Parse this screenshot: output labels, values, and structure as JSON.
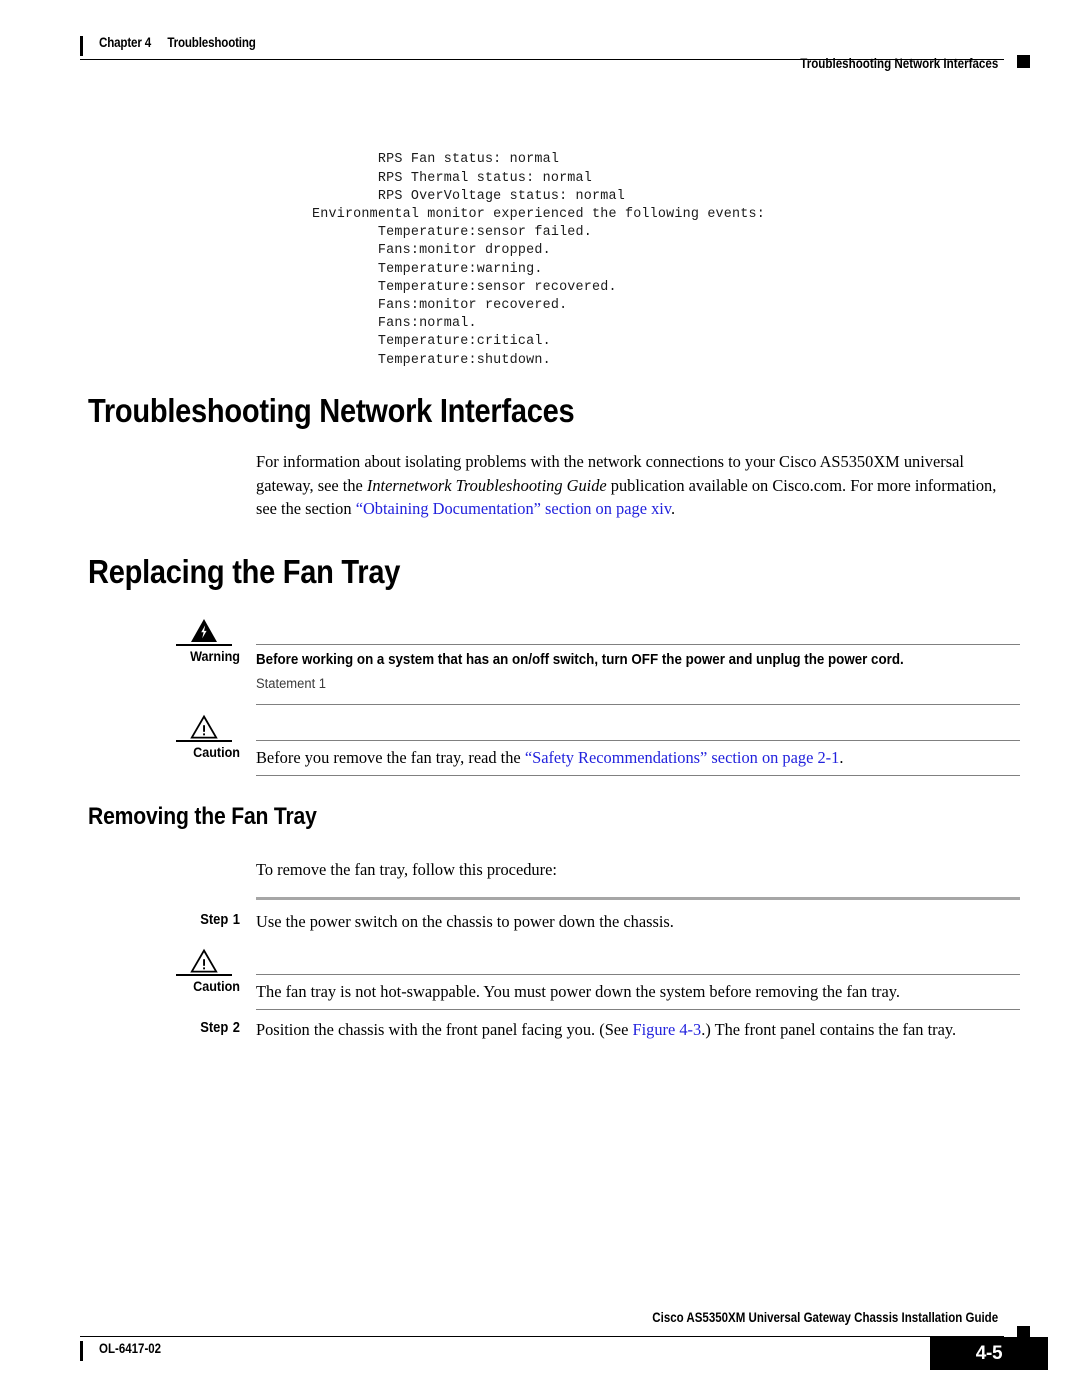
{
  "header": {
    "chapter": "Chapter 4",
    "chapter_title": "Troubleshooting",
    "running_head": "Troubleshooting Network Interfaces"
  },
  "code_block": {
    "text": "        RPS Fan status: normal\n        RPS Thermal status: normal\n        RPS OverVoltage status: normal\nEnvironmental monitor experienced the following events:\n        Temperature:sensor failed.\n        Fans:monitor dropped.\n        Temperature:warning.\n        Temperature:sensor recovered.\n        Fans:monitor recovered.\n        Fans:normal.\n        Temperature:critical.\n        Temperature:shutdown."
  },
  "sections": {
    "network_interfaces": {
      "heading": "Troubleshooting Network Interfaces",
      "paragraph": {
        "part1": "For information about isolating problems with the network connections to your Cisco AS5350XM universal gateway, see the ",
        "italic_title": "Internetwork Troubleshooting Guide",
        "part2": " publication available on Cisco.com. For more information, see the section ",
        "link": "“Obtaining Documentation” section on page xiv",
        "part3": "."
      }
    },
    "replacing_fan_tray": {
      "heading": "Replacing the Fan Tray"
    },
    "removing_fan_tray": {
      "heading": "Removing the Fan Tray",
      "lead_in": "To remove the fan tray, follow this procedure:"
    }
  },
  "notices": {
    "warning": {
      "label": "Warning",
      "icon": "warning-lightning-triangle-icon",
      "text": "Before working on a system that has an on/off switch, turn OFF the power and unplug the power cord.",
      "statement": "Statement 1"
    },
    "caution1": {
      "label": "Caution",
      "icon": "caution-exclamation-triangle-icon",
      "part1": "Before you remove the fan tray, read the ",
      "link": "“Safety Recommendations” section on page 2-1",
      "part2": "."
    },
    "caution2": {
      "label": "Caution",
      "icon": "caution-exclamation-triangle-icon",
      "text": "The fan tray is not hot-swappable. You must power down the system before removing the fan tray."
    }
  },
  "steps": [
    {
      "label": "Step",
      "number": "1",
      "text": "Use the power switch on the chassis to power down the chassis."
    },
    {
      "label": "Step",
      "number": "2",
      "part1": "Position the chassis with the front panel facing you. (See ",
      "link": "Figure 4-3",
      "part2": ".) The front panel contains the fan tray."
    }
  ],
  "footer": {
    "doc_id": "OL-6417-02",
    "guide_title": "Cisco AS5350XM Universal Gateway Chassis Installation Guide",
    "page_number": "4-5"
  },
  "colors": {
    "link": "#2222dd",
    "rule_gray": "#808080",
    "step_rule_gray": "#a6a6a6"
  }
}
